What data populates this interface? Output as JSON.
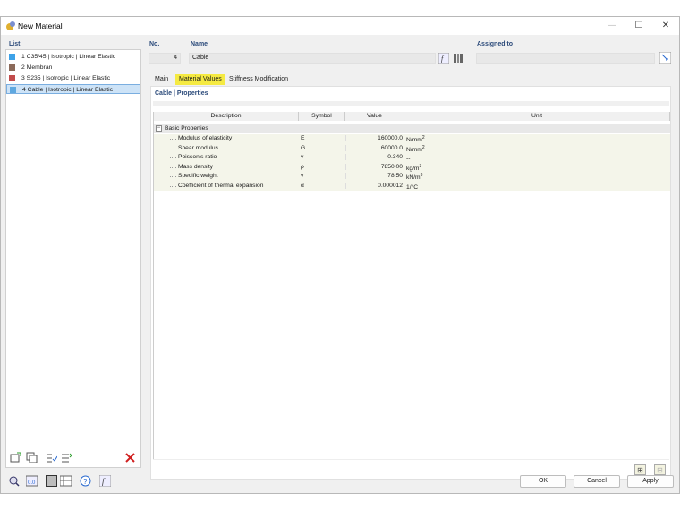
{
  "window": {
    "title": "New Material"
  },
  "list": {
    "label": "List",
    "items": [
      {
        "label": "1  C35/45 | Isotropic | Linear Elastic",
        "color": "#3da2e8"
      },
      {
        "label": "2  Membran",
        "color": "#8b6a5a"
      },
      {
        "label": "3  S235 | Isotropic | Linear Elastic",
        "color": "#c24b4b"
      },
      {
        "label": "4  Cable | Isotropic | Linear Elastic",
        "color": "#5ea8e0"
      }
    ]
  },
  "no": {
    "label": "No.",
    "value": "4"
  },
  "name": {
    "label": "Name",
    "value": "Cable"
  },
  "assigned": {
    "label": "Assigned to",
    "value": ""
  },
  "tabs": [
    {
      "label": "Main"
    },
    {
      "label": "Material Values"
    },
    {
      "label": "Stiffness Modification"
    }
  ],
  "section": {
    "title": "Cable | Properties"
  },
  "table": {
    "headers": [
      "Description",
      "Symbol",
      "Value",
      "Unit"
    ],
    "group": "Basic Properties",
    "rows": [
      {
        "description": "Modulus of elasticity",
        "symbol": "E",
        "value": "160000.0",
        "unit": "N/mm",
        "sup": "2"
      },
      {
        "description": "Shear modulus",
        "symbol": "G",
        "value": "60000.0",
        "unit": "N/mm",
        "sup": "2"
      },
      {
        "description": "Poisson's ratio",
        "symbol": "v",
        "value": "0.340",
        "unit": "--",
        "sup": ""
      },
      {
        "description": "Mass density",
        "symbol": "ρ",
        "value": "7850.00",
        "unit": "kg/m",
        "sup": "3"
      },
      {
        "description": "Specific weight",
        "symbol": "γ",
        "value": "78.50",
        "unit": "kN/m",
        "sup": "3"
      },
      {
        "description": "Coefficient of thermal expansion",
        "symbol": "α",
        "value": "0.000012",
        "unit": "1/°C",
        "sup": ""
      }
    ]
  },
  "buttons": {
    "ok": "OK",
    "cancel": "Cancel",
    "apply": "Apply"
  }
}
